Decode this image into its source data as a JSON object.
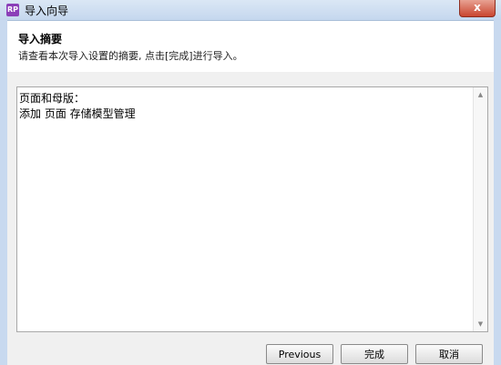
{
  "window": {
    "title": "导入向导",
    "app_icon_text": "RP",
    "close_glyph": "x"
  },
  "header": {
    "title": "导入摘要",
    "description": "请查看本次导入设置的摘要, 点击[完成]进行导入。"
  },
  "summary": {
    "lines": [
      "页面和母版：",
      "添加 页面 存储模型管理"
    ]
  },
  "scrollbar": {
    "up_glyph": "▲",
    "down_glyph": "▼"
  },
  "buttons": {
    "previous": "Previous",
    "finish": "完成",
    "cancel": "取消"
  }
}
